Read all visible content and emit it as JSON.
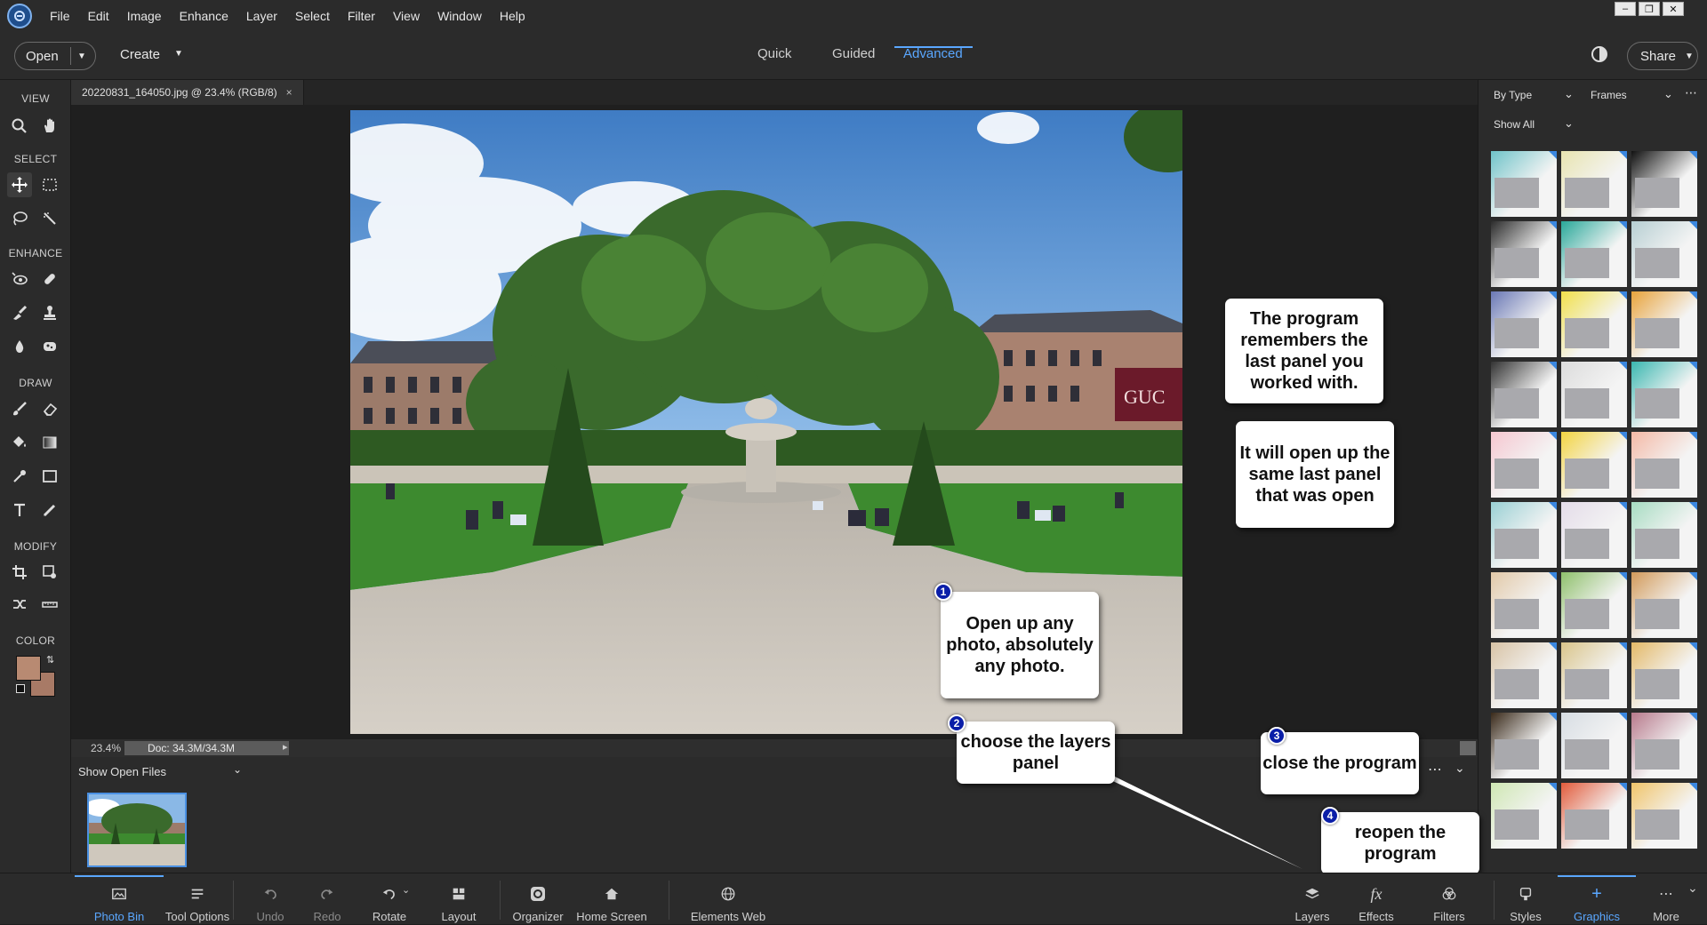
{
  "menu": {
    "items": [
      "File",
      "Edit",
      "Image",
      "Enhance",
      "Layer",
      "Select",
      "Filter",
      "View",
      "Window",
      "Help"
    ]
  },
  "options_bar": {
    "open_label": "Open",
    "create_label": "Create",
    "modes": [
      "Quick",
      "Guided",
      "Advanced"
    ],
    "active_mode": "Advanced",
    "share_label": "Share"
  },
  "toolbar": {
    "sections": {
      "view": "VIEW",
      "select": "SELECT",
      "enhance": "ENHANCE",
      "draw": "DRAW",
      "modify": "MODIFY",
      "color": "COLOR"
    },
    "foreground_color": "#b88a72",
    "background_color": "#a87a66"
  },
  "document": {
    "tab_title": "20220831_164050.jpg @ 23.4% (RGB/8)",
    "zoom": "23.4%",
    "doc_info": "Doc: 34.3M/34.3M"
  },
  "photo_bin": {
    "dropdown_label": "Show Open Files"
  },
  "right_panel": {
    "filter_by": "By Type",
    "category": "Frames",
    "show": "Show All",
    "frame_count": 30
  },
  "taskbar": {
    "left": [
      {
        "label": "Photo Bin",
        "icon": "photo-bin-icon"
      },
      {
        "label": "Tool Options",
        "icon": "tool-options-icon"
      },
      {
        "label": "Undo",
        "icon": "undo-icon"
      },
      {
        "label": "Redo",
        "icon": "redo-icon"
      },
      {
        "label": "Rotate",
        "icon": "rotate-icon"
      },
      {
        "label": "Layout",
        "icon": "layout-icon"
      },
      {
        "label": "Organizer",
        "icon": "organizer-icon"
      },
      {
        "label": "Home Screen",
        "icon": "home-icon"
      },
      {
        "label": "Elements Web",
        "icon": "globe-icon"
      }
    ],
    "right": [
      {
        "label": "Layers",
        "icon": "layers-icon"
      },
      {
        "label": "Effects",
        "icon": "fx-icon"
      },
      {
        "label": "Filters",
        "icon": "filters-icon"
      },
      {
        "label": "Styles",
        "icon": "styles-icon"
      },
      {
        "label": "Graphics",
        "icon": "graphics-icon"
      },
      {
        "label": "More",
        "icon": "more-icon"
      }
    ]
  },
  "callouts": {
    "remembers": "The program remembers the last panel you worked with.",
    "will_open": "It will open up the same last panel that was open",
    "step1": {
      "num": "1",
      "text": "Open up any photo, absolutely any photo."
    },
    "step2": {
      "num": "2",
      "text": "choose the layers panel"
    },
    "step3": {
      "num": "3",
      "text": "close the program"
    },
    "step4": {
      "num": "4",
      "text": "reopen the program"
    }
  },
  "colors": {
    "accent": "#5aa7ff",
    "badge": "#0a1ea8"
  }
}
